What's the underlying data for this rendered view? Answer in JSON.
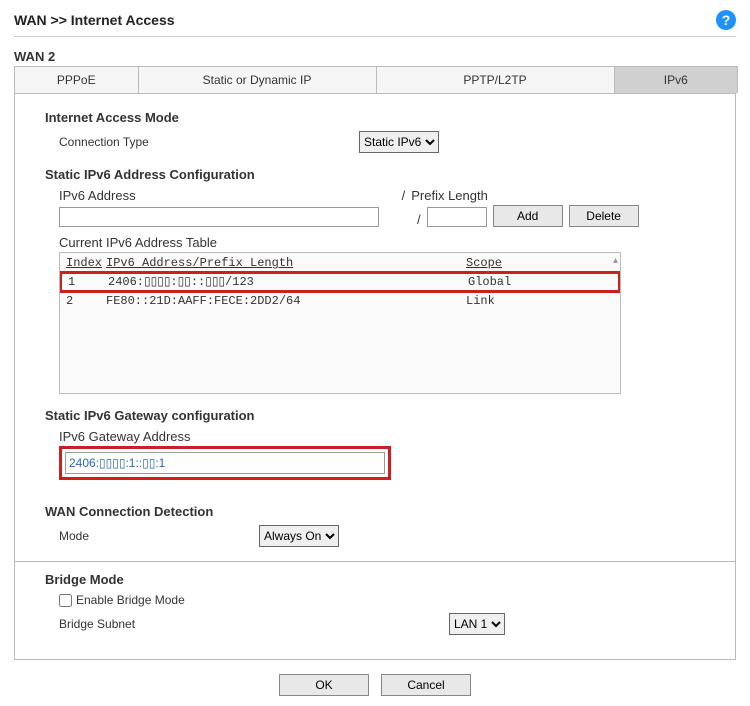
{
  "breadcrumb": "WAN >> Internet Access",
  "wan_label": "WAN 2",
  "tabs": {
    "ppoe": "PPPoE",
    "static": "Static or Dynamic IP",
    "pptp": "PPTP/L2TP",
    "ipv6": "IPv6"
  },
  "mode_section": {
    "title": "Internet Access Mode",
    "conn_type_label": "Connection Type",
    "conn_type_value": "Static IPv6"
  },
  "addr_section": {
    "title": "Static IPv6 Address Configuration",
    "ipv6_label": "IPv6 Address",
    "prefix_label": "Prefix Length",
    "slash": "/",
    "add_btn": "Add",
    "del_btn": "Delete",
    "table_title": "Current IPv6 Address Table",
    "headers": {
      "idx": "Index",
      "addr": "IPv6 Address/Prefix Length",
      "scope": "Scope"
    },
    "rows": [
      {
        "idx": "1",
        "addr": "2406:▯▯▯▯:▯▯::▯▯▯/123",
        "scope": "Global",
        "highlight": true
      },
      {
        "idx": "2",
        "addr": "FE80::21D:AAFF:FECE:2DD2/64",
        "scope": "Link",
        "highlight": false
      }
    ]
  },
  "gateway_section": {
    "title": "Static IPv6 Gateway configuration",
    "label": "IPv6 Gateway Address",
    "value": "2406:▯▯▯▯:1::▯▯:1"
  },
  "detect_section": {
    "title": "WAN Connection Detection",
    "mode_label": "Mode",
    "mode_value": "Always On"
  },
  "bridge_section": {
    "title": "Bridge Mode",
    "enable_label": "Enable Bridge Mode",
    "subnet_label": "Bridge Subnet",
    "subnet_value": "LAN 1"
  },
  "buttons": {
    "ok": "OK",
    "cancel": "Cancel"
  }
}
